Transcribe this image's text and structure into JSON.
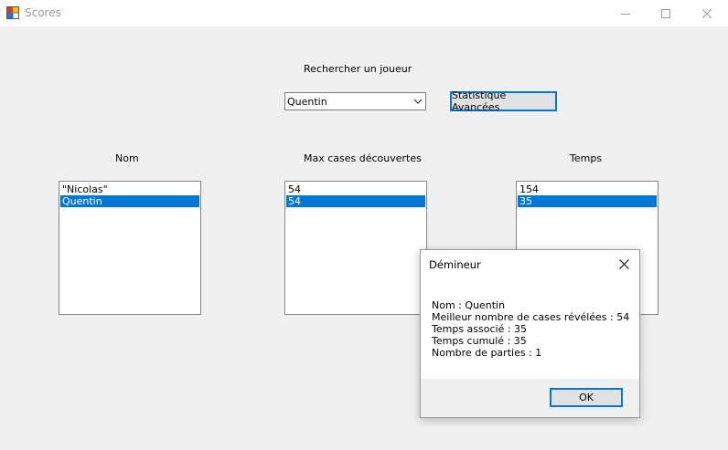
{
  "window": {
    "title": "Scores"
  },
  "search": {
    "label": "Rechercher un joueur",
    "selected_player": "Quentin",
    "stats_button": "Statistique Avancées"
  },
  "columns": {
    "name": {
      "header": "Nom",
      "items": [
        "\"Nicolas\"",
        "Quentin"
      ],
      "selected_index": 1
    },
    "max_cells": {
      "header": "Max cases découvertes",
      "items": [
        "54",
        "54"
      ],
      "selected_index": 1
    },
    "time": {
      "header": "Temps",
      "items": [
        "154",
        "35"
      ],
      "selected_index": 1
    }
  },
  "dialog": {
    "title": "Démineur",
    "lines": [
      "Nom : Quentin",
      "Meilleur nombre de cases révélées : 54",
      "Temps associé : 35",
      "Temps cumulé : 35",
      "Nombre de parties : 1"
    ],
    "ok_label": "OK"
  },
  "colors": {
    "selection": "#0078d7",
    "background": "#f0f0f0"
  }
}
